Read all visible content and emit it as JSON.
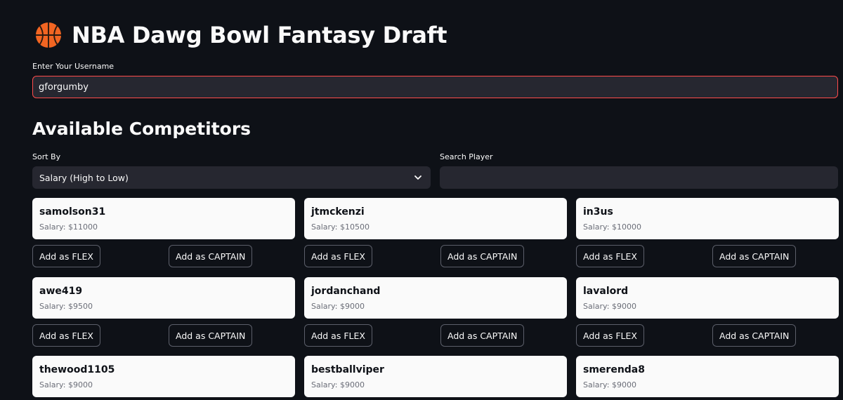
{
  "header": {
    "title": "NBA Dawg Bowl Fantasy Draft",
    "icon": "basketball-icon"
  },
  "username": {
    "label": "Enter Your Username",
    "value": "gforgumby"
  },
  "competitors": {
    "title": "Available Competitors",
    "sort_label": "Sort By",
    "sort_value": "Salary (High to Low)",
    "search_label": "Search Player",
    "search_value": "",
    "flex_label": "Add as FLEX",
    "captain_label": "Add as CAPTAIN",
    "players": [
      {
        "name": "samolson31",
        "salary": "Salary: $11000"
      },
      {
        "name": "jtmckenzi",
        "salary": "Salary: $10500"
      },
      {
        "name": "in3us",
        "salary": "Salary: $10000"
      },
      {
        "name": "awe419",
        "salary": "Salary: $9500"
      },
      {
        "name": "jordanchand",
        "salary": "Salary: $9000"
      },
      {
        "name": "lavalord",
        "salary": "Salary: $9000"
      },
      {
        "name": "thewood1105",
        "salary": "Salary: $9000"
      },
      {
        "name": "bestballviper",
        "salary": "Salary: $9000"
      },
      {
        "name": "smerenda8",
        "salary": "Salary: $9000"
      }
    ]
  },
  "colors": {
    "background": "#0e1117",
    "input_bg": "#262730",
    "focus_border": "#ff4b4b",
    "card_bg": "#fafafa",
    "basketball": "#f26522"
  }
}
